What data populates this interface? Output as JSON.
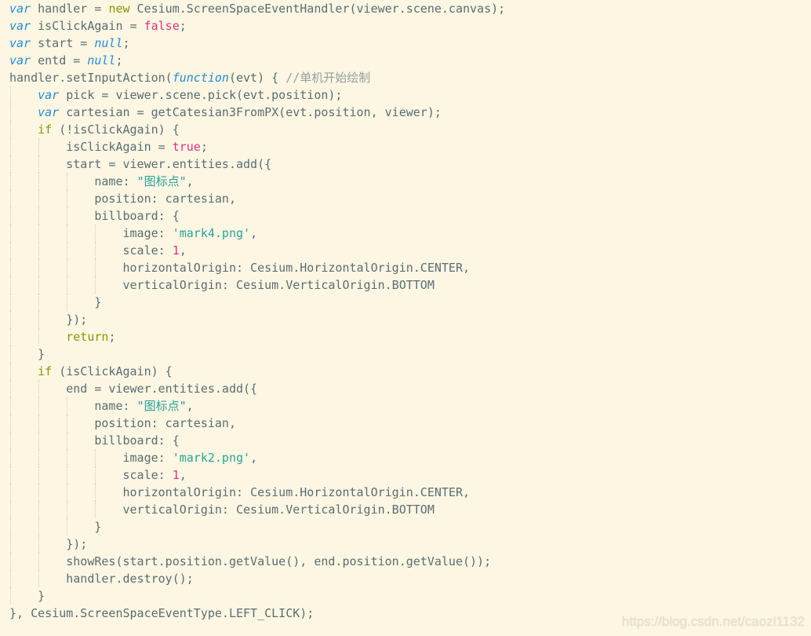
{
  "colors": {
    "background": "#fdf6e3",
    "plain": "#586e75",
    "keyword": "#268bd2",
    "literal": "#d33682",
    "string": "#2aa198",
    "comment": "#93a1a1",
    "flow": "#859900"
  },
  "watermark": "https://blog.csdn.net/caozl1132",
  "code": {
    "lines": [
      {
        "indent": 0,
        "tokens": [
          {
            "t": "var",
            "k": "keyword"
          },
          {
            "t": " handler = ",
            "k": "plain"
          },
          {
            "t": "new",
            "k": "flow"
          },
          {
            "t": " Cesium.ScreenSpaceEventHandler(viewer.scene.canvas);",
            "k": "plain"
          }
        ]
      },
      {
        "indent": 0,
        "tokens": [
          {
            "t": "var",
            "k": "keyword"
          },
          {
            "t": " isClickAgain = ",
            "k": "plain"
          },
          {
            "t": "false",
            "k": "bool"
          },
          {
            "t": ";",
            "k": "plain"
          }
        ]
      },
      {
        "indent": 0,
        "tokens": [
          {
            "t": "var",
            "k": "keyword"
          },
          {
            "t": " start = ",
            "k": "plain"
          },
          {
            "t": "null",
            "k": "keyword"
          },
          {
            "t": ";",
            "k": "plain"
          }
        ]
      },
      {
        "indent": 0,
        "tokens": [
          {
            "t": "var",
            "k": "keyword"
          },
          {
            "t": " entd = ",
            "k": "plain"
          },
          {
            "t": "null",
            "k": "keyword"
          },
          {
            "t": ";",
            "k": "plain"
          }
        ]
      },
      {
        "indent": 0,
        "tokens": [
          {
            "t": "handler.setInputAction(",
            "k": "plain"
          },
          {
            "t": "function",
            "k": "keyword"
          },
          {
            "t": "(evt) { ",
            "k": "plain"
          },
          {
            "t": "//单机开始绘制",
            "k": "comment"
          }
        ]
      },
      {
        "indent": 1,
        "tokens": [
          {
            "t": "var",
            "k": "keyword"
          },
          {
            "t": " pick = viewer.scene.pick(evt.position);",
            "k": "plain"
          }
        ]
      },
      {
        "indent": 1,
        "tokens": [
          {
            "t": "var",
            "k": "keyword"
          },
          {
            "t": " cartesian = getCatesian3FromPX(evt.position, viewer);",
            "k": "plain"
          }
        ]
      },
      {
        "indent": 1,
        "tokens": [
          {
            "t": "if",
            "k": "flow"
          },
          {
            "t": " (!isClickAgain) {",
            "k": "plain"
          }
        ]
      },
      {
        "indent": 2,
        "tokens": [
          {
            "t": "isClickAgain = ",
            "k": "plain"
          },
          {
            "t": "true",
            "k": "bool"
          },
          {
            "t": ";",
            "k": "plain"
          }
        ]
      },
      {
        "indent": 2,
        "tokens": [
          {
            "t": "start = viewer.entities.add({",
            "k": "plain"
          }
        ]
      },
      {
        "indent": 3,
        "tokens": [
          {
            "t": "name: ",
            "k": "plain"
          },
          {
            "t": "\"图标点\"",
            "k": "string"
          },
          {
            "t": ",",
            "k": "plain"
          }
        ]
      },
      {
        "indent": 3,
        "tokens": [
          {
            "t": "position: cartesian,",
            "k": "plain"
          }
        ]
      },
      {
        "indent": 3,
        "tokens": [
          {
            "t": "billboard: {",
            "k": "plain"
          }
        ]
      },
      {
        "indent": 4,
        "tokens": [
          {
            "t": "image: ",
            "k": "plain"
          },
          {
            "t": "'mark4.png'",
            "k": "string"
          },
          {
            "t": ",",
            "k": "plain"
          }
        ]
      },
      {
        "indent": 4,
        "tokens": [
          {
            "t": "scale: ",
            "k": "plain"
          },
          {
            "t": "1",
            "k": "number"
          },
          {
            "t": ",",
            "k": "plain"
          }
        ]
      },
      {
        "indent": 4,
        "tokens": [
          {
            "t": "horizontalOrigin: Cesium.HorizontalOrigin.CENTER,",
            "k": "plain"
          }
        ]
      },
      {
        "indent": 4,
        "tokens": [
          {
            "t": "verticalOrigin: Cesium.VerticalOrigin.BOTTOM",
            "k": "plain"
          }
        ]
      },
      {
        "indent": 3,
        "tokens": [
          {
            "t": "}",
            "k": "plain"
          }
        ]
      },
      {
        "indent": 2,
        "tokens": [
          {
            "t": "});",
            "k": "plain"
          }
        ]
      },
      {
        "indent": 2,
        "tokens": [
          {
            "t": "return",
            "k": "flow"
          },
          {
            "t": ";",
            "k": "plain"
          }
        ]
      },
      {
        "indent": 1,
        "tokens": [
          {
            "t": "}",
            "k": "plain"
          }
        ]
      },
      {
        "indent": 1,
        "tokens": [
          {
            "t": "if",
            "k": "flow"
          },
          {
            "t": " (isClickAgain) {",
            "k": "plain"
          }
        ]
      },
      {
        "indent": 2,
        "tokens": [
          {
            "t": "end = viewer.entities.add({",
            "k": "plain"
          }
        ]
      },
      {
        "indent": 3,
        "tokens": [
          {
            "t": "name: ",
            "k": "plain"
          },
          {
            "t": "\"图标点\"",
            "k": "string"
          },
          {
            "t": ",",
            "k": "plain"
          }
        ]
      },
      {
        "indent": 3,
        "tokens": [
          {
            "t": "position: cartesian,",
            "k": "plain"
          }
        ]
      },
      {
        "indent": 3,
        "tokens": [
          {
            "t": "billboard: {",
            "k": "plain"
          }
        ]
      },
      {
        "indent": 4,
        "tokens": [
          {
            "t": "image: ",
            "k": "plain"
          },
          {
            "t": "'mark2.png'",
            "k": "string"
          },
          {
            "t": ",",
            "k": "plain"
          }
        ]
      },
      {
        "indent": 4,
        "tokens": [
          {
            "t": "scale: ",
            "k": "plain"
          },
          {
            "t": "1",
            "k": "number"
          },
          {
            "t": ",",
            "k": "plain"
          }
        ]
      },
      {
        "indent": 4,
        "tokens": [
          {
            "t": "horizontalOrigin: Cesium.HorizontalOrigin.CENTER,",
            "k": "plain"
          }
        ]
      },
      {
        "indent": 4,
        "tokens": [
          {
            "t": "verticalOrigin: Cesium.VerticalOrigin.BOTTOM",
            "k": "plain"
          }
        ]
      },
      {
        "indent": 3,
        "tokens": [
          {
            "t": "}",
            "k": "plain"
          }
        ]
      },
      {
        "indent": 2,
        "tokens": [
          {
            "t": "});",
            "k": "plain"
          }
        ]
      },
      {
        "indent": 2,
        "tokens": [
          {
            "t": "showRes(start.position.getValue(), end.position.getValue());",
            "k": "plain"
          }
        ]
      },
      {
        "indent": 2,
        "tokens": [
          {
            "t": "handler.destroy();",
            "k": "plain"
          }
        ]
      },
      {
        "indent": 1,
        "tokens": [
          {
            "t": "}",
            "k": "plain"
          }
        ]
      },
      {
        "indent": 0,
        "tokens": [
          {
            "t": "}, Cesium.ScreenSpaceEventType.LEFT_CLICK);",
            "k": "plain"
          }
        ]
      }
    ]
  }
}
